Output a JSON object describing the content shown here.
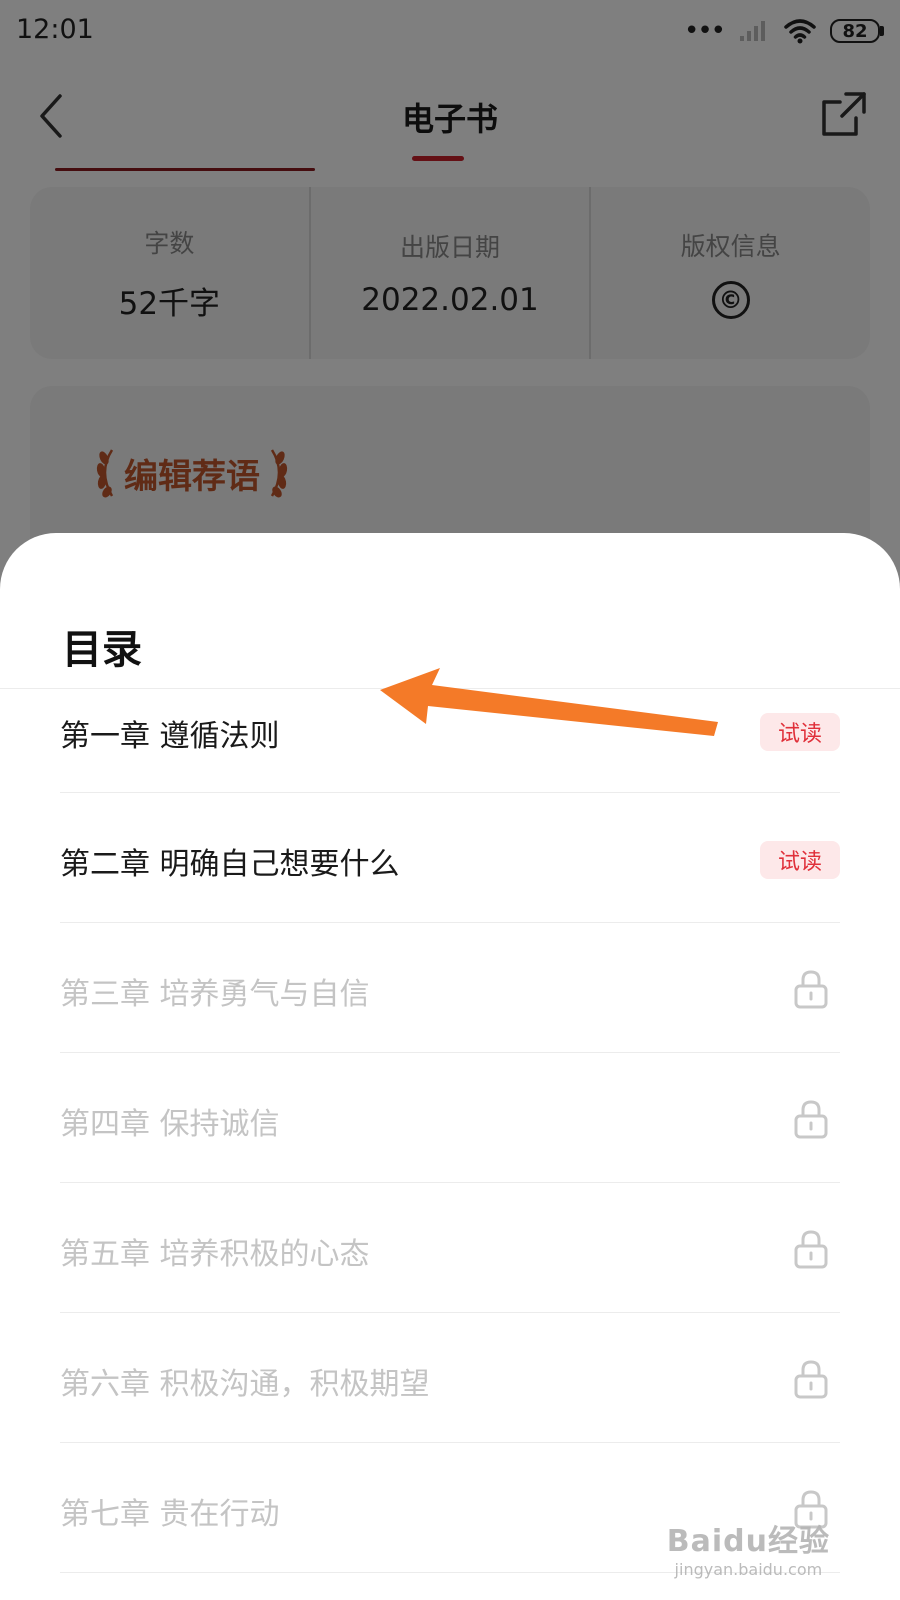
{
  "status_bar": {
    "time": "12:01",
    "battery": "82"
  },
  "nav": {
    "title": "电子书"
  },
  "book_info": [
    {
      "label": "字数",
      "value": "52千字"
    },
    {
      "label": "出版日期",
      "value": "2022.02.01"
    },
    {
      "label": "版权信息",
      "value": "©"
    }
  ],
  "editor": {
    "title": "编辑荐语"
  },
  "catalog": {
    "title": "目录",
    "chapters": [
      {
        "title": "第一章 遵循法则",
        "badge": "试读",
        "locked": false
      },
      {
        "title": "第二章 明确自己想要什么",
        "badge": "试读",
        "locked": false
      },
      {
        "title": "第三章 培养勇气与自信",
        "locked": true
      },
      {
        "title": "第四章 保持诚信",
        "locked": true
      },
      {
        "title": "第五章 培养积极的心态",
        "locked": true
      },
      {
        "title": "第六章 积极沟通，积极期望",
        "locked": true
      },
      {
        "title": "第七章 贵在行动",
        "locked": true
      }
    ]
  },
  "annotation": {
    "arrow_color": "#f47a28"
  },
  "watermark": {
    "main": "Baidu经验",
    "sub": "jingyan.baidu.com"
  },
  "colors": {
    "accent": "#c8202a",
    "trial_bg": "#fde8e9",
    "trial_text": "#e0303a",
    "locked_text": "#c4c4c4"
  }
}
